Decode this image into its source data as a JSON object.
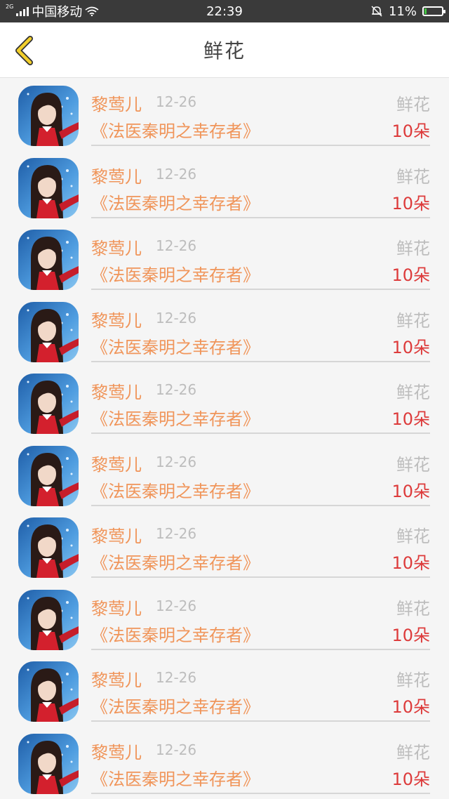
{
  "status_bar": {
    "network_type": "2G",
    "carrier": "中国移动",
    "time": "22:39",
    "battery_percent": "11%",
    "battery_level": 0.11,
    "icons": [
      "signal-icon",
      "wifi-icon",
      "silent-bell-icon",
      "battery-charging-icon"
    ]
  },
  "header": {
    "back_icon": "chevron-left-icon",
    "title": "鲜花"
  },
  "colors": {
    "accent_orange": "#f0955a",
    "quantity_red": "#dd3b3b",
    "muted_gray": "#bdbdbd",
    "back_icon_yellow": "#f2cf2b"
  },
  "items": [
    {
      "name": "黎莺儿",
      "date": "12-26",
      "gift_type": "鲜花",
      "book_title": "《法医秦明之幸存者》",
      "quantity": "10朵"
    },
    {
      "name": "黎莺儿",
      "date": "12-26",
      "gift_type": "鲜花",
      "book_title": "《法医秦明之幸存者》",
      "quantity": "10朵"
    },
    {
      "name": "黎莺儿",
      "date": "12-26",
      "gift_type": "鲜花",
      "book_title": "《法医秦明之幸存者》",
      "quantity": "10朵"
    },
    {
      "name": "黎莺儿",
      "date": "12-26",
      "gift_type": "鲜花",
      "book_title": "《法医秦明之幸存者》",
      "quantity": "10朵"
    },
    {
      "name": "黎莺儿",
      "date": "12-26",
      "gift_type": "鲜花",
      "book_title": "《法医秦明之幸存者》",
      "quantity": "10朵"
    },
    {
      "name": "黎莺儿",
      "date": "12-26",
      "gift_type": "鲜花",
      "book_title": "《法医秦明之幸存者》",
      "quantity": "10朵"
    },
    {
      "name": "黎莺儿",
      "date": "12-26",
      "gift_type": "鲜花",
      "book_title": "《法医秦明之幸存者》",
      "quantity": "10朵"
    },
    {
      "name": "黎莺儿",
      "date": "12-26",
      "gift_type": "鲜花",
      "book_title": "《法医秦明之幸存者》",
      "quantity": "10朵"
    },
    {
      "name": "黎莺儿",
      "date": "12-26",
      "gift_type": "鲜花",
      "book_title": "《法医秦明之幸存者》",
      "quantity": "10朵"
    },
    {
      "name": "黎莺儿",
      "date": "12-26",
      "gift_type": "鲜花",
      "book_title": "《法医秦明之幸存者》",
      "quantity": "10朵"
    }
  ]
}
